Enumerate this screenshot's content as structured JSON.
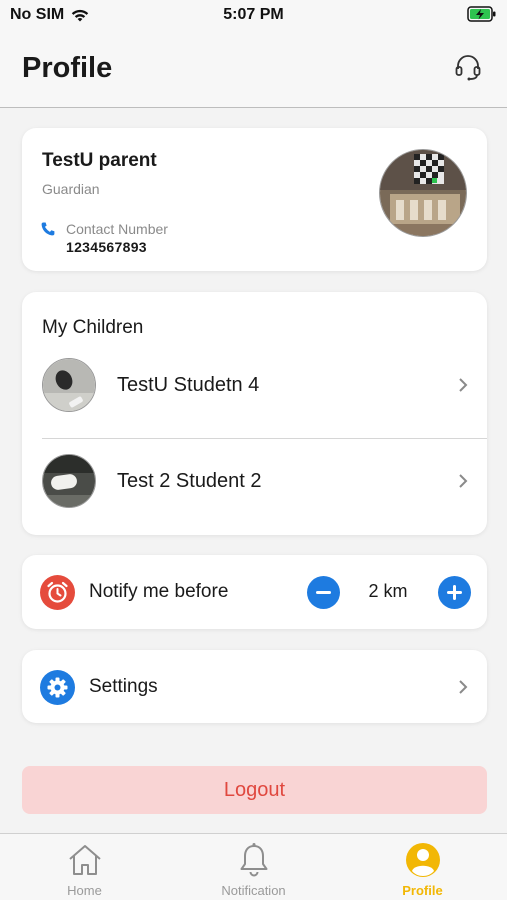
{
  "status_bar": {
    "carrier": "No SIM",
    "time": "5:07 PM"
  },
  "header": {
    "title": "Profile",
    "support_icon": "headset-icon"
  },
  "profile": {
    "name": "TestU parent",
    "role": "Guardian",
    "contact_label": "Contact Number",
    "contact_value": "1234567893"
  },
  "children": {
    "title": "My Children",
    "items": [
      {
        "name": "TestU Studetn 4"
      },
      {
        "name": "Test 2 Student 2"
      }
    ]
  },
  "notify": {
    "label": "Notify me before",
    "value": "2 km"
  },
  "settings": {
    "label": "Settings"
  },
  "logout": {
    "label": "Logout"
  },
  "tabs": [
    {
      "label": "Home",
      "icon": "home-icon"
    },
    {
      "label": "Notification",
      "icon": "bell-icon"
    },
    {
      "label": "Profile",
      "icon": "user-icon"
    }
  ],
  "colors": {
    "accent_blue": "#1e7be0",
    "alarm_red": "#e54b3c",
    "logout_bg": "#f9d4d4",
    "logout_text": "#e0483f",
    "active_tab": "#f2b705"
  }
}
